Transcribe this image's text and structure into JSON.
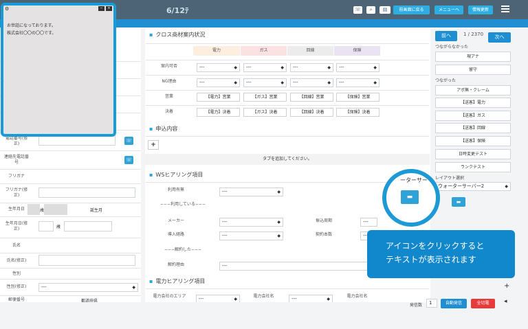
{
  "topbar": {
    "date": "6/12ﾃ",
    "icons": [
      "phone-icon",
      "search-icon",
      "id-card-icon"
    ],
    "buttons": [
      "前画面に戻る",
      "メニューへ",
      "情報更新"
    ]
  },
  "popup": {
    "lines": [
      "お世話になっております。",
      "株式会社〇〇の〇〇です。"
    ]
  },
  "left": {
    "rows": [
      "電話番号(修正)",
      "連絡先電話番号",
      "フリガナ",
      "フリガナ(修正)",
      "生年月日",
      "生年月日(修正)",
      "氏名",
      "氏名(修正)",
      "性別",
      "性別(修正)",
      "郵便番号"
    ],
    "age_label": "歳",
    "birth_label": "誕生月",
    "zip_label2": "都道府県",
    "select_default": "---"
  },
  "cross": {
    "title": "クロス商材案内状況",
    "columns": [
      "電力",
      "ガス",
      "回線",
      "保険"
    ],
    "row_labels": [
      "案内可否",
      "NG理由",
      "営業",
      "決着"
    ],
    "select_default": "---",
    "eigyo": [
      "【電力】営業",
      "【ガス】営業",
      "【回線】営業",
      "【保険】営業"
    ],
    "kecchaku": [
      "【電力】決着",
      "【ガス】決着",
      "【回線】決着",
      "【保険】決着"
    ]
  },
  "moshikomi": {
    "title": "申込内容",
    "add": "+",
    "hint": "タブを追加してください。"
  },
  "ws": {
    "title": "WSヒアリング項目",
    "riyou": "利用有無",
    "using": "−−−利用している−−−",
    "maker": "メーカー",
    "dounyu": "導入経路",
    "furikomi": "振込周期",
    "keiyaku": "契約本数",
    "kaiyaku": "−−−解約した−−−",
    "kaiyaku_riyu": "解約理由",
    "select_default": "---"
  },
  "denryoku": {
    "title": "電力ヒアリング項目",
    "area": "電力会社のエリア",
    "company1": "電力会社名",
    "company2": "電力会社名",
    "select_default": "---"
  },
  "right": {
    "prev": "前へ",
    "counter": "1 / 2370",
    "next": "次へ",
    "not_connected": "つながらなかった",
    "btns_a": [
      "現アナ",
      "留守"
    ],
    "connected": "つながった",
    "btns_b": [
      "アポ無・クレーム",
      "【送客】電力",
      "【送客】ガス",
      "【送客】回線",
      "【送客】保険",
      "日時変更テスト",
      "ランクテスト"
    ],
    "layout_label": "レイアウト選択",
    "layout_value": "ウォーターサーバー2",
    "layout_hint": "ーターサー"
  },
  "bottom": {
    "hatsushin_label": "発信数",
    "hatsushin_value": "1",
    "auto": "自動発信",
    "hangup": "全切電"
  },
  "tooltip": {
    "line1": "アイコンをクリックすると",
    "line2": "テキストが表示されます"
  }
}
